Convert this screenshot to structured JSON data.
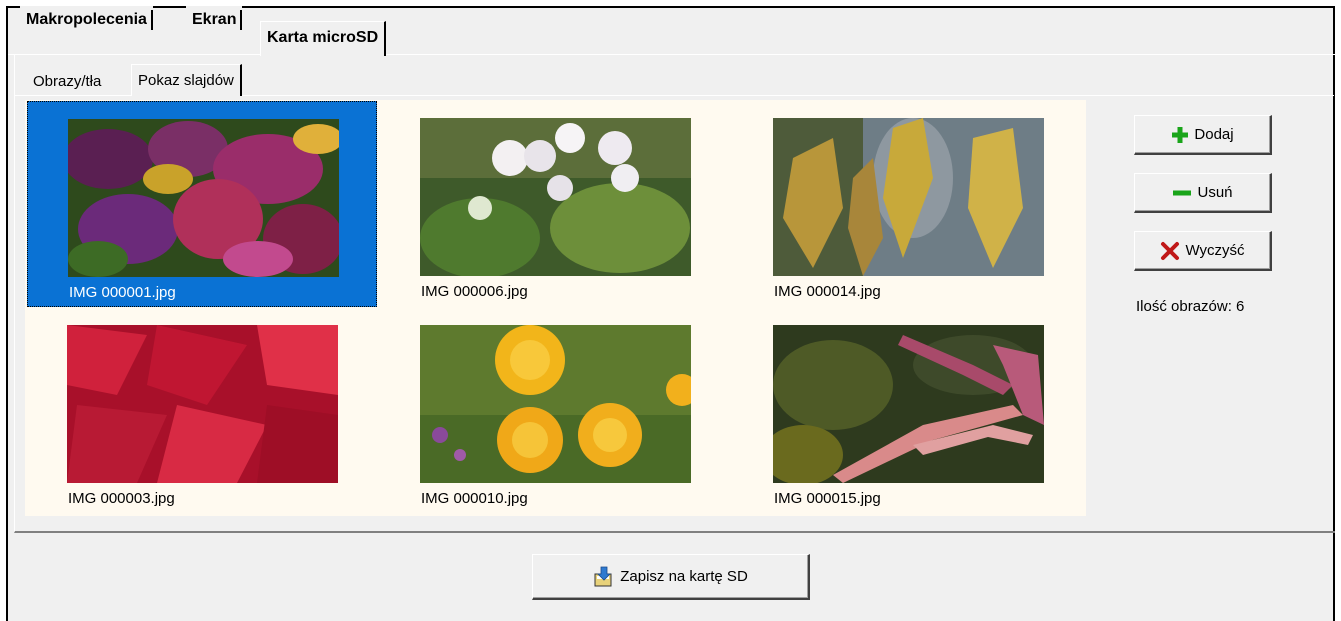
{
  "top_tabs": [
    {
      "label": "Makropolecenia",
      "active": false
    },
    {
      "label": "Ekran",
      "active": false
    },
    {
      "label": "Karta microSD",
      "active": true
    }
  ],
  "sub_tabs": [
    {
      "label": "Obrazy/tła",
      "active": false
    },
    {
      "label": "Pokaz slajdów",
      "active": true
    }
  ],
  "images": [
    {
      "filename": "IMG 000001.jpg",
      "selected": true
    },
    {
      "filename": "IMG 000006.jpg",
      "selected": false
    },
    {
      "filename": "IMG 000014.jpg",
      "selected": false
    },
    {
      "filename": "IMG 000003.jpg",
      "selected": false
    },
    {
      "filename": "IMG 000010.jpg",
      "selected": false
    },
    {
      "filename": "IMG 000015.jpg",
      "selected": false
    }
  ],
  "actions": {
    "add_label": "Dodaj",
    "remove_label": "Usuń",
    "clear_label": "Wyczyść",
    "count_text": "Ilość obrazów: 6",
    "save_label": "Zapisz na kartę SD"
  },
  "colors": {
    "selection": "#0a72d4",
    "gallery_bg": "#fffaf0",
    "add_icon": "#1aa51a",
    "remove_icon": "#1aa51a",
    "clear_icon": "#c01818"
  }
}
